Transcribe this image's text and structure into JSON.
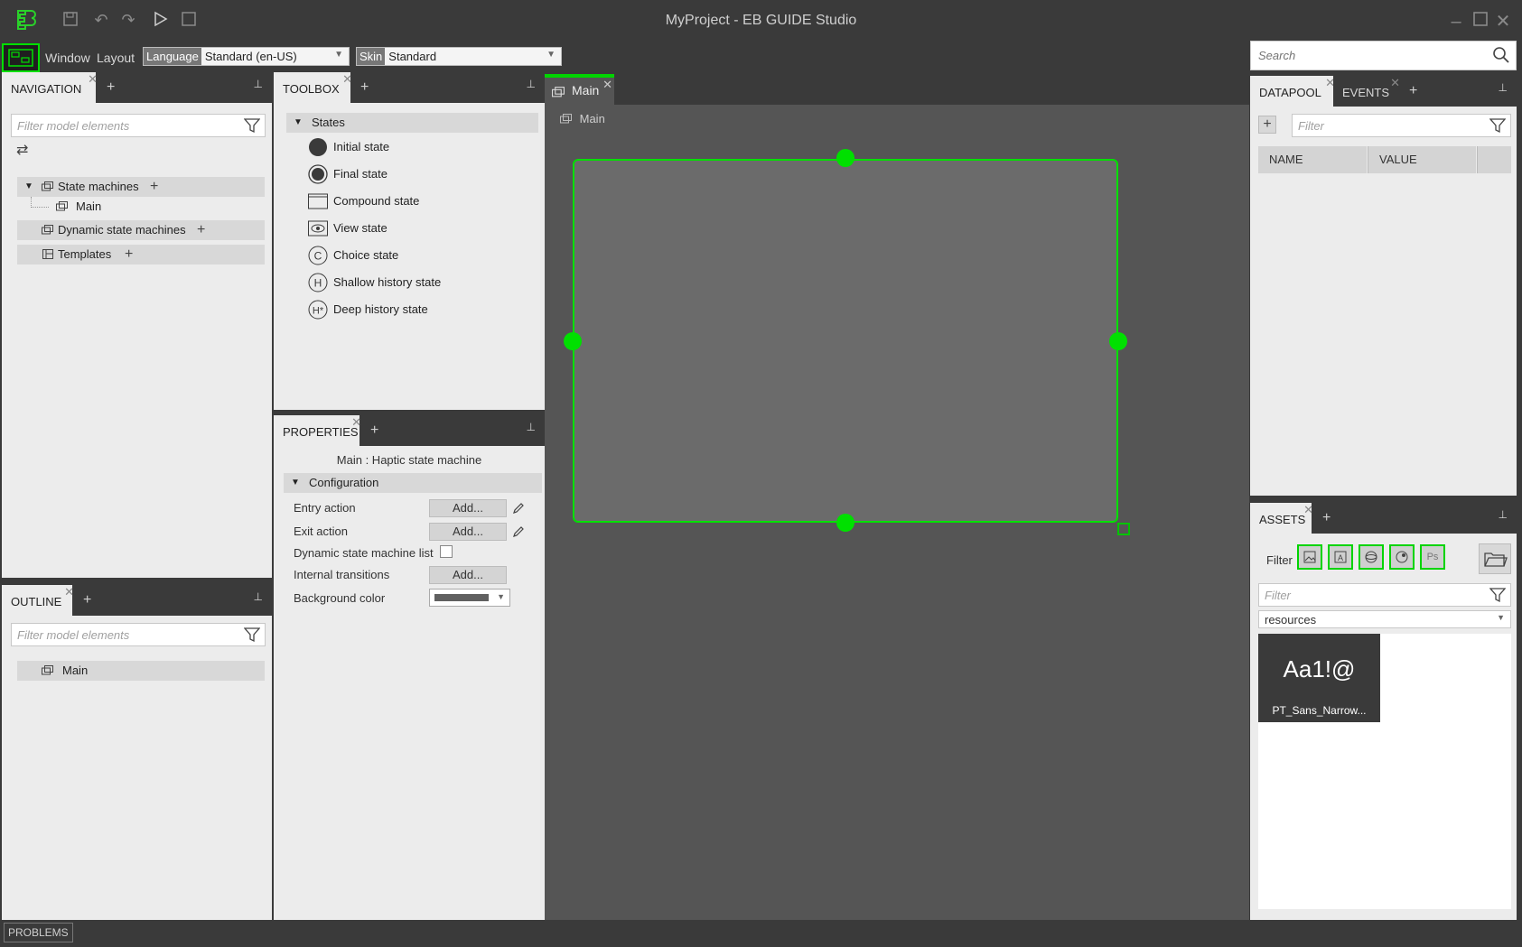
{
  "window": {
    "title": "MyProject - EB GUIDE Studio"
  },
  "menubar": {
    "window_label": "Window",
    "layout_label": "Layout",
    "language_tag": "Language",
    "language_value": "Standard (en-US)",
    "skin_tag": "Skin",
    "skin_value": "Standard",
    "search_placeholder": "Search"
  },
  "navigation": {
    "tab_label": "NAVIGATION",
    "filter_placeholder": "Filter model elements",
    "items": [
      {
        "label": "State machines"
      },
      {
        "label": "Main"
      },
      {
        "label": "Dynamic state machines"
      },
      {
        "label": "Templates"
      }
    ]
  },
  "outline": {
    "tab_label": "OUTLINE",
    "filter_placeholder": "Filter model elements",
    "items": [
      {
        "label": "Main"
      }
    ]
  },
  "toolbox": {
    "tab_label": "TOOLBOX",
    "group_label": "States",
    "items": [
      {
        "label": "Initial state",
        "icon": "initial-state-icon"
      },
      {
        "label": "Final state",
        "icon": "final-state-icon"
      },
      {
        "label": "Compound state",
        "icon": "compound-state-icon"
      },
      {
        "label": "View state",
        "icon": "view-state-icon"
      },
      {
        "label": "Choice state",
        "icon": "choice-state-icon"
      },
      {
        "label": "Shallow history state",
        "icon": "shallow-history-icon"
      },
      {
        "label": "Deep history state",
        "icon": "deep-history-icon"
      }
    ]
  },
  "properties": {
    "tab_label": "PROPERTIES",
    "subject": "Main : Haptic state machine",
    "group_label": "Configuration",
    "rows": [
      {
        "label": "Entry action",
        "button": "Add..."
      },
      {
        "label": "Exit action",
        "button": "Add..."
      },
      {
        "label": "Dynamic state machine list"
      },
      {
        "label": "Internal transitions",
        "button": "Add..."
      },
      {
        "label": "Background color"
      }
    ],
    "background_color": "#606060"
  },
  "editor": {
    "tab_label": "Main",
    "breadcrumb": "Main",
    "accent_color": "#00e000"
  },
  "datapool": {
    "tab_label": "DATAPOOL",
    "events_tab_label": "EVENTS",
    "filter_placeholder": "Filter",
    "columns": [
      "NAME",
      "VALUE"
    ]
  },
  "assets": {
    "tab_label": "ASSETS",
    "filter_label": "Filter",
    "filter_placeholder": "Filter",
    "folder_value": "resources",
    "tile_preview": "Aa1!@",
    "tile_name": "PT_Sans_Narrow..."
  },
  "statusbar": {
    "problems_label": "PROBLEMS"
  }
}
